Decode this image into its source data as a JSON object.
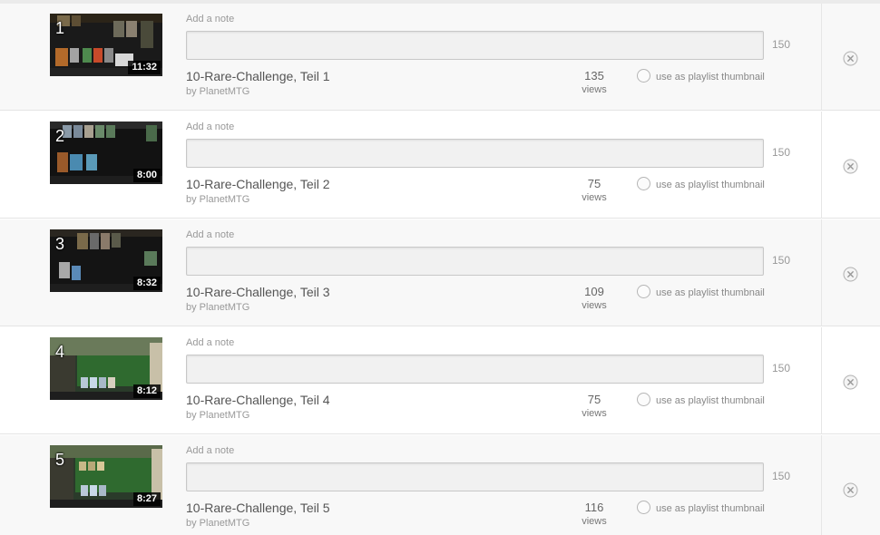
{
  "playlist": {
    "items": [
      {
        "index": "1",
        "duration": "11:32",
        "note_label": "Add a note",
        "note_value": "",
        "char_limit": "150",
        "title": "10-Rare-Challenge, Teil 1",
        "byline": "by PlanetMTG",
        "views_count": "135",
        "views_label": "views",
        "thumbnail_option": "use as playlist thumbnail"
      },
      {
        "index": "2",
        "duration": "8:00",
        "note_label": "Add a note",
        "note_value": "",
        "char_limit": "150",
        "title": "10-Rare-Challenge, Teil 2",
        "byline": "by PlanetMTG",
        "views_count": "75",
        "views_label": "views",
        "thumbnail_option": "use as playlist thumbnail"
      },
      {
        "index": "3",
        "duration": "8:32",
        "note_label": "Add a note",
        "note_value": "",
        "char_limit": "150",
        "title": "10-Rare-Challenge, Teil 3",
        "byline": "by PlanetMTG",
        "views_count": "109",
        "views_label": "views",
        "thumbnail_option": "use as playlist thumbnail"
      },
      {
        "index": "4",
        "duration": "8:12",
        "note_label": "Add a note",
        "note_value": "",
        "char_limit": "150",
        "title": "10-Rare-Challenge, Teil 4",
        "byline": "by PlanetMTG",
        "views_count": "75",
        "views_label": "views",
        "thumbnail_option": "use as playlist thumbnail"
      },
      {
        "index": "5",
        "duration": "8:27",
        "note_label": "Add a note",
        "note_value": "",
        "char_limit": "150",
        "title": "10-Rare-Challenge, Teil 5",
        "byline": "by PlanetMTG",
        "views_count": "116",
        "views_label": "views",
        "thumbnail_option": "use as playlist thumbnail"
      }
    ]
  },
  "icons": {
    "remove": "remove-circle-x-icon",
    "thumbnail_radio": "radio-circle-icon"
  },
  "colors": {
    "row_alt_bg": "#f8f8f8",
    "row_bg": "#ffffff",
    "input_bg": "#f1f1f1",
    "text_muted": "#999999",
    "title_text": "#555555"
  }
}
